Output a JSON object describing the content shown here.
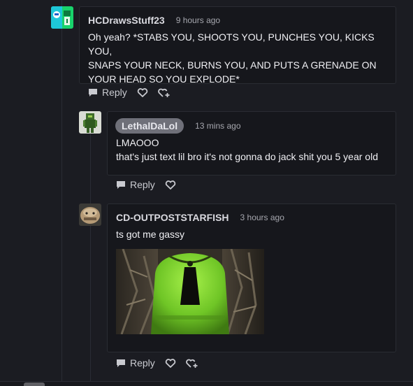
{
  "comments": [
    {
      "username": "HCDrawsStuff23",
      "time": "9 hours ago",
      "lines": [
        "Oh yeah? *STABS YOU, SHOOTS YOU, PUNCHES YOU, KICKS YOU,",
        "SNAPS YOUR NECK, BURNS YOU, AND PUTS A GRENADE ON",
        "YOUR HEAD SO YOU EXPLODE*"
      ],
      "reply_label": "Reply"
    },
    {
      "username": "LethalDaLol",
      "time": "13 mins ago",
      "lines": [
        "LMAOOO",
        "that's just text lil bro it's not gonna do jack shit you 5 year old"
      ],
      "reply_label": "Reply"
    },
    {
      "username": "CD-OUTPOSTSTARFISH",
      "time": "3 hours ago",
      "lines": [
        "ts got me gassy"
      ],
      "reply_label": "Reply"
    }
  ],
  "icons": {
    "reply": "speech-bubble-icon",
    "like": "heart-icon",
    "favorite": "heart-plus-icon"
  },
  "colors": {
    "background": "#1b1c22",
    "card": "#16171c",
    "highlight_pill": "#6f7079"
  }
}
